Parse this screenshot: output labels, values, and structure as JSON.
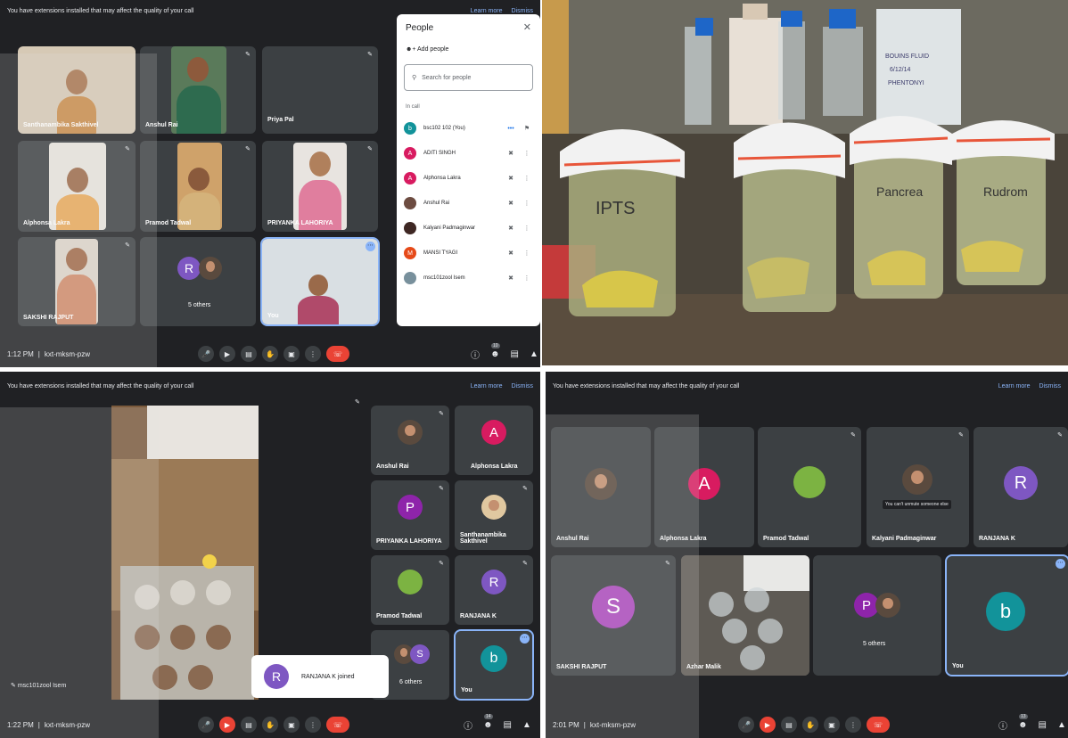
{
  "colors": {
    "meet_bg": "#202124",
    "tile_bg": "#3c4043",
    "link": "#8ab4f8",
    "end_call": "#ea4335"
  },
  "q1": {
    "banner": {
      "text": "You have extensions installed that may affect the quality of your call",
      "learn_more": "Learn more",
      "dismiss": "Dismiss"
    },
    "tiles": {
      "t1": "Santhanambika Sakthivel",
      "t2": "Anshul Rai",
      "t3": "Priya Pal",
      "t4": "Alphonsa Lakra",
      "t5": "Pramod Tadwal",
      "t6": "PRIYANKA LAHORIYA",
      "t7": "SAKSHI RAJPUT",
      "t8_avatar": "R",
      "t8": "5 others",
      "t9": "You"
    },
    "people": {
      "title": "People",
      "add": "Add people",
      "search_placeholder": "Search for people",
      "in_call": "In call",
      "rows": [
        {
          "initial": "b",
          "name": "bsc102 102 (You)",
          "color": "#12939a"
        },
        {
          "initial": "A",
          "name": "ADITI SINGH",
          "color": "#d81b60"
        },
        {
          "initial": "A",
          "name": "Alphonsa Lakra",
          "color": "#d81b60"
        },
        {
          "initial": "",
          "name": "Anshul Rai",
          "color": "#6d4c41"
        },
        {
          "initial": "",
          "name": "Kalyani Padmaginwar",
          "color": "#3e2723"
        },
        {
          "initial": "M",
          "name": "MANSI TYAGI",
          "color": "#e64a19"
        },
        {
          "initial": "",
          "name": "msc101zool Isem",
          "color": "#78909c"
        }
      ]
    },
    "bottom": {
      "time": "1:12 PM",
      "code": "kxt-mksm-pzw",
      "participants": "10"
    }
  },
  "q2": {
    "label_lines": [
      "BOUINS FLUID",
      "6/12/14",
      "PHENTONYI"
    ],
    "jar_labels": [
      "IPTS",
      "Pancrea",
      "Rudrom"
    ]
  },
  "q3": {
    "banner": {
      "text": "You have extensions installed that may affect the quality of your call",
      "learn_more": "Learn more",
      "dismiss": "Dismiss"
    },
    "tiles": {
      "s1": "Anshul Rai",
      "s2_avatar": "A",
      "s2": "Alphonsa Lakra",
      "s3_avatar": "P",
      "s3": "PRIYANKA LAHORIYA",
      "s4": "Santhanambika Sakthivel",
      "s5": "Pramod Tadwal",
      "s6_avatar": "R",
      "s6": "RANJANA K",
      "s7_avatar": "S",
      "s7": "6 others",
      "s8_avatar": "b",
      "s8": "You"
    },
    "presenter": "msc101zool Isem",
    "toast": {
      "avatar": "R",
      "text": "RANJANA K joined"
    },
    "bottom": {
      "time": "1:22 PM",
      "code": "kxt-mksm-pzw",
      "participants": "14"
    }
  },
  "q4": {
    "banner": {
      "text": "You have extensions installed that may affect the quality of your call",
      "learn_more": "Learn more",
      "dismiss": "Dismiss"
    },
    "tiles": {
      "r1": "Anshul Rai",
      "r2_avatar": "A",
      "r2": "Alphonsa Lakra",
      "r3": "Pramod Tadwal",
      "r4": "Kalyani Padmaginwar",
      "r4_msg": "You can't unmute someone else",
      "r5_avatar": "R",
      "r5": "RANJANA K",
      "r6_avatar": "S",
      "r6": "SAKSHI RAJPUT",
      "r7": "Azhar Malik",
      "r8_avatar": "P",
      "r8": "5 others",
      "r9_avatar": "b",
      "r9": "You"
    },
    "bottom": {
      "time": "2:01 PM",
      "code": "kxt-mksm-pzw",
      "participants": "13"
    }
  }
}
